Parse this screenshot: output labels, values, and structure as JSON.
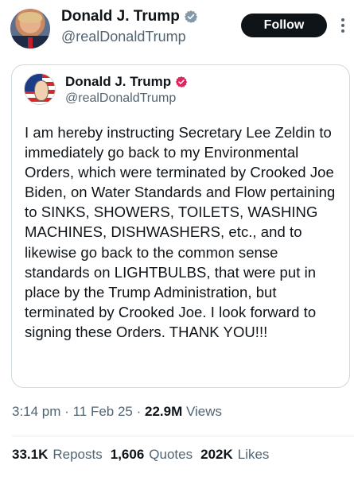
{
  "author": {
    "name": "Donald J. Trump",
    "handle": "@realDonaldTrump",
    "verified_badge": "gray-check-badge-icon",
    "badge_color": "#829aab"
  },
  "follow_button": {
    "label": "Follow",
    "bg": "#0f1419"
  },
  "more_icon": "more-vertical-icon",
  "quoted": {
    "name": "Donald J. Trump",
    "handle": "@realDonaldTrump",
    "verified_badge": "red-check-badge-icon",
    "badge_color": "#e0245e",
    "text": "I am hereby instructing Secretary Lee Zeldin to immediately go back to my Environmental Orders, which were terminated by Crooked Joe Biden, on Water Standards and Flow pertaining to SINKS, SHOWERS, TOILETS, WASHING MACHINES, DISHWASHERS, etc., and to likewise go back to the common sense standards on LIGHTBULBS, that were put in place by the Trump Administration, but terminated by Crooked Joe. I look forward to signing these Orders. THANK YOU!!!"
  },
  "meta": {
    "time": "3:14 pm",
    "sep": "·",
    "date": "11 Feb 25",
    "views_count": "22.9M",
    "views_label": "Views"
  },
  "stats": {
    "reposts_count": "33.1K",
    "reposts_label": "Reposts",
    "quotes_count": "1,606",
    "quotes_label": "Quotes",
    "likes_count": "202K",
    "likes_label": "Likes"
  }
}
